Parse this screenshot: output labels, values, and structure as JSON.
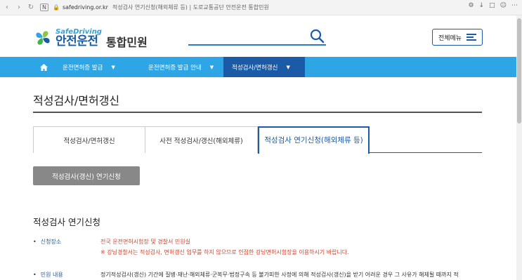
{
  "browser": {
    "url_host": "safedriving.or.kr",
    "tab_title": "적성검사 연기신청(해외체류 등) | 도로교통공단 안전운전 통합민원"
  },
  "header": {
    "logo_en": "SafeDriving",
    "logo_ko": "안전운전",
    "logo_sub": "통합민원",
    "search_value": "",
    "menu_label": "전체메뉴"
  },
  "nav": {
    "items": [
      {
        "label": "운전면허증 발급"
      },
      {
        "label": "운전면허증 발급 안내"
      },
      {
        "label": "적성검사/면허갱신"
      }
    ]
  },
  "page": {
    "title": "적성검사/면허갱신",
    "tabs": [
      {
        "label": "적성검사/면허갱신"
      },
      {
        "label": "사전 적성검사/갱신(해외체류)"
      },
      {
        "label": "적성검사 연기신청(해외체류 등)"
      }
    ],
    "apply_button": "적성검사(갱신) 연기신청",
    "section_title": "적성검사 연기신청",
    "rows": [
      {
        "label": "신청장소",
        "line1": "전국 운전면허시험장 및 경찰서 민원실",
        "line2": "※ 강남경찰서는 적성검사, 면허갱신 업무를 하지 않으므로 인접한 강남면허시험장을 이용하시기 바랍니다."
      },
      {
        "label": "민원 내용",
        "line1": "정기적성검사(갱신) 기간에 질병·재난·해외체류·군복무·법정구속 등 불가피한 사정에 의해 적성검사(갱신)을 받기 어려운 경우 그 사유가 해제될 때까지 적"
      }
    ]
  },
  "colors": {
    "nav_bg": "#2ea6e6",
    "nav_active": "#1a5aa6",
    "accent": "#1a5aa6",
    "warn": "#d0452e"
  }
}
